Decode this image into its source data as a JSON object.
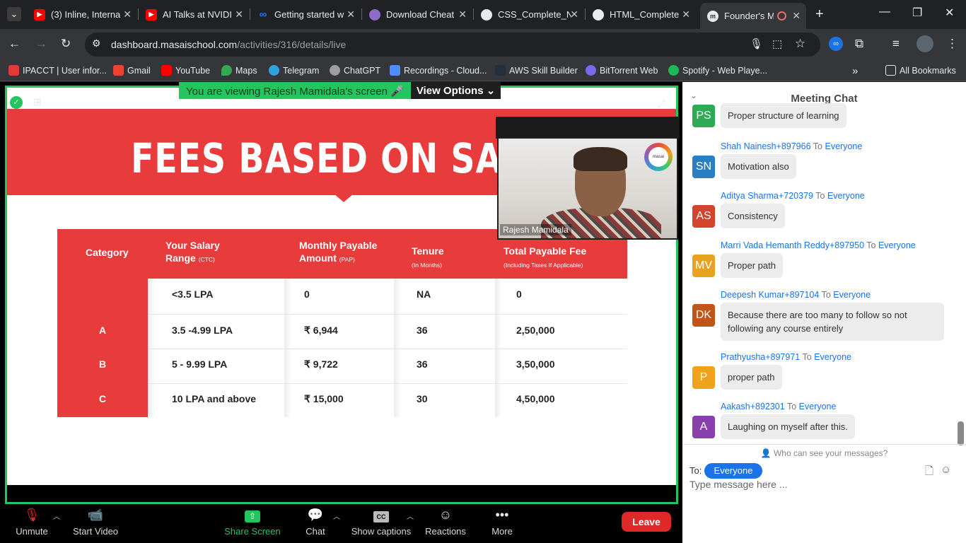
{
  "browser": {
    "tabs": [
      {
        "title": "(3) Inline, Interna",
        "icon": "youtube-icon",
        "color": "#ff0000"
      },
      {
        "title": "AI Talks at NVIDI",
        "icon": "youtube-icon",
        "color": "#ff0000"
      },
      {
        "title": "Getting started w",
        "icon": "meta-icon",
        "color": "#1877f2"
      },
      {
        "title": "Download Cheat",
        "icon": "doc-icon",
        "color": "#8e6ac9"
      },
      {
        "title": "CSS_Complete_N",
        "icon": "github-icon",
        "color": "#6e7681"
      },
      {
        "title": "HTML_Complete",
        "icon": "github-icon",
        "color": "#6e7681"
      },
      {
        "title": "Founder's M",
        "icon": "masai-icon",
        "color": "#ffffff",
        "active": true
      }
    ],
    "url_host": "dashboard.masaischool.com",
    "url_path": "/activities/316/details/live",
    "bookmarks": [
      {
        "label": "IPACCT | User infor...",
        "color": "#e53935"
      },
      {
        "label": "Gmail",
        "color": "#ea4335"
      },
      {
        "label": "YouTube",
        "color": "#ff0000"
      },
      {
        "label": "Maps",
        "color": "#34a853"
      },
      {
        "label": "Telegram",
        "color": "#2aa3df"
      },
      {
        "label": "ChatGPT",
        "color": "#9e9e9e"
      },
      {
        "label": "Recordings - Cloud...",
        "color": "#4f8cff"
      },
      {
        "label": "AWS Skill Builder",
        "color": "#232f3e"
      },
      {
        "label": "BitTorrent Web",
        "color": "#7a67ee"
      },
      {
        "label": "Spotify - Web Playe...",
        "color": "#1db954"
      }
    ],
    "all_bookmarks": "All Bookmarks",
    "overflow": "»"
  },
  "meeting": {
    "viewing_msg": "You are viewing Rajesh Mamidala's screen",
    "view_options": "View Options",
    "slide": {
      "title": "FEES BASED ON SALARY T",
      "headers": [
        {
          "main": "Category",
          "sub": ""
        },
        {
          "main": "Your Salary Range",
          "sub": "(CTC)"
        },
        {
          "main": "Monthly Payable Amount",
          "sub": "(PAP)"
        },
        {
          "main": "Tenure",
          "sub": "(In Months)"
        },
        {
          "main": "Total Payable Fee",
          "sub": "(Including Taxes If Applicable)"
        }
      ],
      "rows": [
        {
          "category": "",
          "salary": "<3.5 LPA",
          "monthly": "0",
          "tenure": "NA",
          "total": "0"
        },
        {
          "category": "A",
          "salary": "3.5 -4.99 LPA",
          "monthly": "₹ 6,944",
          "tenure": "36",
          "total": "2,50,000"
        },
        {
          "category": "B",
          "salary": "5 - 9.99 LPA",
          "monthly": "₹ 9,722",
          "tenure": "36",
          "total": "3,50,000"
        },
        {
          "category": "C",
          "salary": "10 LPA and above",
          "monthly": "₹ 15,000",
          "tenure": "30",
          "total": "4,50,000"
        }
      ]
    },
    "video_name": "Rajesh Mamidala",
    "video_logo": "masai",
    "controls": {
      "unmute": "Unmute",
      "start_video": "Start Video",
      "share_screen": "Share Screen",
      "chat": "Chat",
      "captions": "Show captions",
      "reactions": "Reactions",
      "more": "More",
      "leave": "Leave"
    }
  },
  "chat": {
    "title": "Meeting Chat",
    "to_label": "Everyone",
    "messages": [
      {
        "initials": "PS",
        "color": "#2eaa54",
        "sender": "",
        "to": "",
        "text": "Proper structure of learning"
      },
      {
        "initials": "SN",
        "color": "#2a7fc4",
        "sender": "Shah Nainesh+897966",
        "to": "Everyone",
        "text": "Motivation also"
      },
      {
        "initials": "AS",
        "color": "#d2452b",
        "sender": "Aditya Sharma+720379",
        "to": "Everyone",
        "text": "Consistency"
      },
      {
        "initials": "MV",
        "color": "#e8a21f",
        "sender": "Marri Vada Hemanth Reddy+897950",
        "to": "Everyone",
        "text": "Proper path"
      },
      {
        "initials": "DK",
        "color": "#c0541a",
        "sender": "Deepesh Kumar+897104",
        "to": "Everyone",
        "text": "Because there are too many to follow so not following any course entirely"
      },
      {
        "initials": "P",
        "color": "#f0a21a",
        "sender": "Prathyusha+897971",
        "to": "Everyone",
        "text": "proper path"
      },
      {
        "initials": "A",
        "color": "#8a3fae",
        "sender": "Aakash+892301",
        "to": "Everyone",
        "text": "Laughing on myself after this."
      }
    ],
    "who_can_see": "Who can see your messages?",
    "to_prefix": "To:",
    "recipient": "Everyone",
    "input_placeholder": "Type message here ..."
  }
}
